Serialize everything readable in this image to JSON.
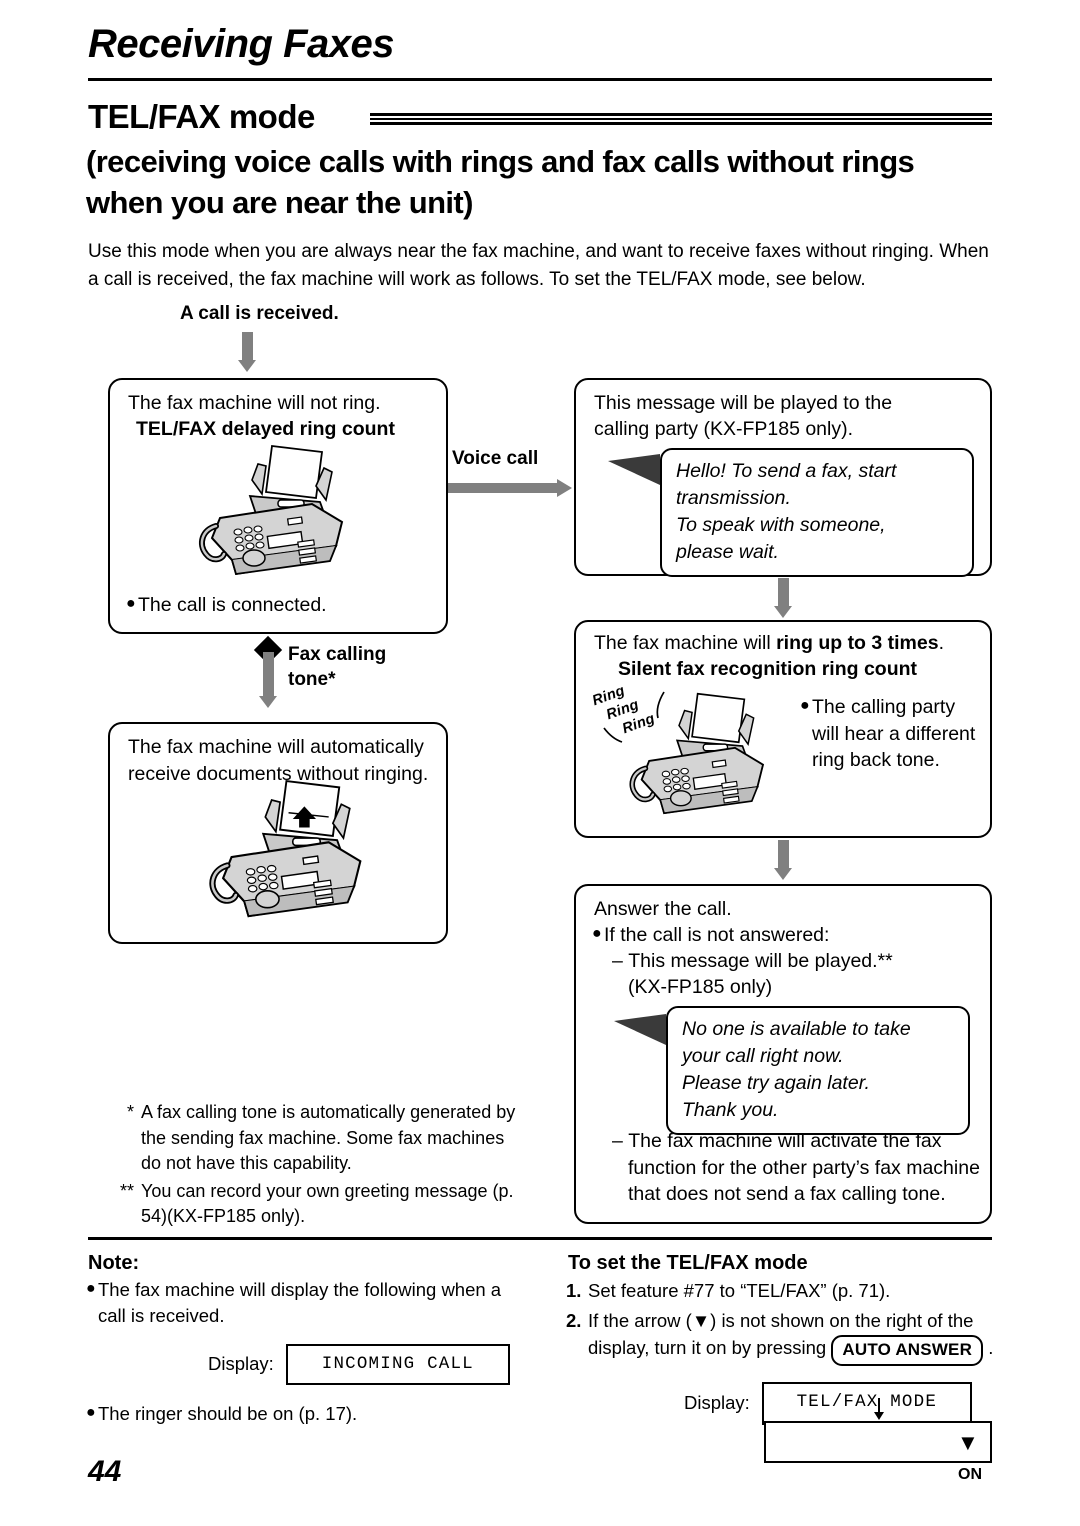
{
  "header": {
    "chapter_title": "Receiving Faxes",
    "section_title": "TEL/FAX mode",
    "section_subtitle": "(receiving voice calls with rings and fax calls without rings when you are near the unit)",
    "intro": "Use this mode when you are always near the fax machine, and want to receive faxes without ringing. When a call is received, the fax machine will work as follows. To set the TEL/FAX mode, see below."
  },
  "flow": {
    "start_label": "A call is received.",
    "voice_call_label": "Voice call",
    "fax_calling_tone_label_1": "Fax calling",
    "fax_calling_tone_label_2": "tone*",
    "left_box_1": {
      "line1": "The fax machine will not ring.",
      "line2_bold": "TEL/FAX delayed ring count",
      "bullet": "The call is connected."
    },
    "left_box_2": {
      "text": "The fax machine will automatically receive documents without ringing."
    },
    "right_box_1": {
      "line1": "This message will be played to the",
      "line2": "calling party (KX-FP185 only).",
      "bubble": [
        "Hello! To send a fax, start",
        "transmission.",
        "To speak with someone,",
        "please wait."
      ]
    },
    "right_box_2": {
      "line1_a": "The fax machine will ",
      "line1_bold": "ring up to 3 times",
      "line1_b": ".",
      "line2_bold": "Silent fax recognition ring count",
      "ring_sound": [
        "Ring",
        "Ring",
        "Ring"
      ],
      "bullet": [
        "The calling party",
        "will hear a different",
        "ring back tone."
      ]
    },
    "right_box_3": {
      "line1": "Answer the call.",
      "bullet1": "If the call is not answered:",
      "dash1_a": "This message will be played.**",
      "dash1_b": "(KX-FP185 only)",
      "bubble": [
        "No one is available to take",
        "your call right now.",
        "Please try again later.",
        "Thank you."
      ],
      "dash2": "The fax machine will activate the fax function for the other party’s fax machine that does not send a fax calling tone."
    }
  },
  "footnotes": [
    {
      "marker": "*",
      "text": "A fax calling tone is automatically generated by the sending fax machine. Some fax machines do not have this capability."
    },
    {
      "marker": "**",
      "text": "You can record your own greeting message (p. 54)(KX-FP185 only)."
    }
  ],
  "note": {
    "heading": "Note:",
    "items": [
      "The fax machine will display the following when a call is received.",
      "The ringer should be on (p. 17)."
    ],
    "display_label": "Display:",
    "display_value": "INCOMING CALL"
  },
  "set_mode": {
    "heading": "To set the TEL/FAX mode",
    "step1": "Set feature #77 to “TEL/FAX” (p. 71).",
    "step1_num": "1.",
    "step2_num": "2.",
    "step2_a": "If the arrow (▼) is not shown on the right of the display, turn it on by pressing ",
    "step2_key": "AUTO ANSWER",
    "step2_b": " .",
    "display_label": "Display:",
    "display_value": "TEL/FAX MODE",
    "arrow_glyph": "▼",
    "on_label": "ON"
  },
  "page_number": "44",
  "colors": {
    "ink": "#000000",
    "arrow_grey": "#808080",
    "bubble_tail": "#3a3a3a",
    "machine_body": "#d4d4d4"
  }
}
